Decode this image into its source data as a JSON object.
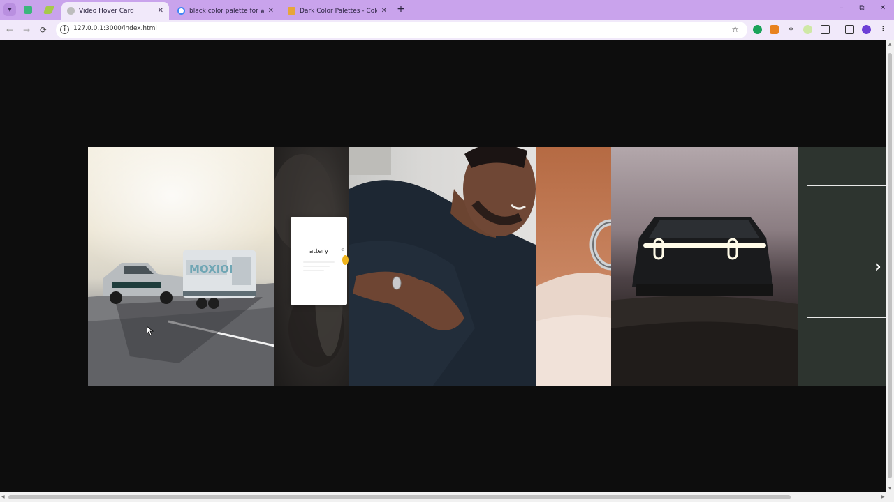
{
  "browser": {
    "tabs": [
      {
        "title": "Video Hover Card",
        "active": true,
        "favicon": "globe-icon"
      },
      {
        "title": "black color palette for website",
        "active": false,
        "favicon": "google-icon"
      },
      {
        "title": "Dark Color Palettes - Color Hunt",
        "active": false,
        "favicon": "color-hunt-icon"
      }
    ],
    "url": "127.0.0.1:3000/index.html",
    "icons": {
      "tab_search": "▾",
      "new_tab": "+",
      "minimize": "–",
      "restore": "⧉",
      "close": "✕",
      "back": "←",
      "forward": "→",
      "reload": "⟳",
      "site_info": "i",
      "bookmark": "☆",
      "extensions": "⋮"
    }
  },
  "page": {
    "hover_card": {
      "label": "attery"
    },
    "next_glyph": "›"
  },
  "colors": {
    "chrome": "#c9a3ec",
    "toolbar": "#f1e9fa",
    "page_bg": "#0d0d0d",
    "accent_badge": "#f1b51c"
  }
}
